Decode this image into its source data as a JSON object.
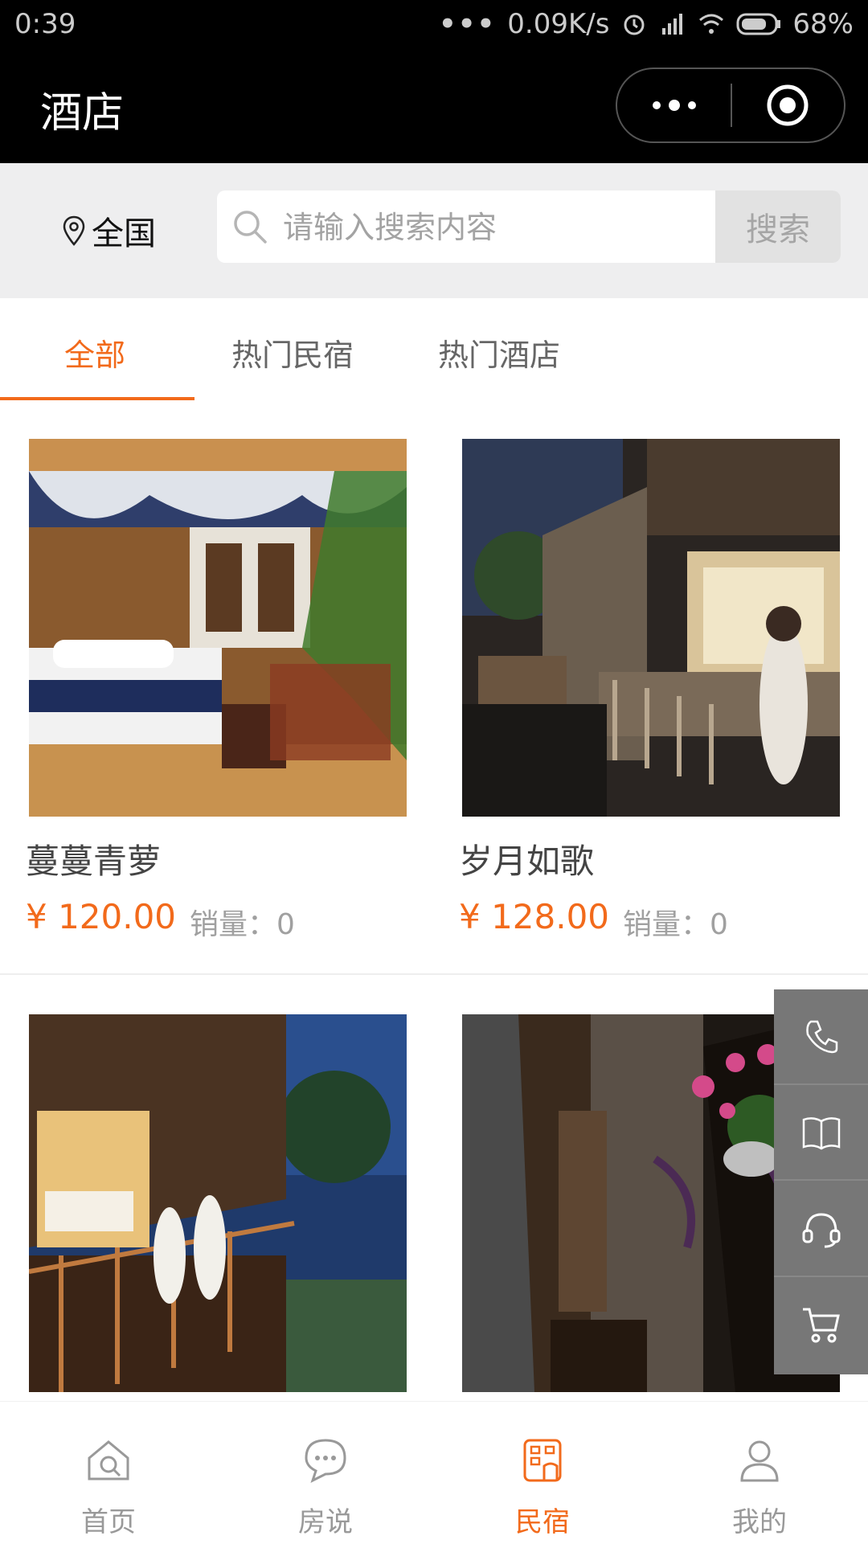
{
  "status_bar": {
    "time": "0:39",
    "dots": "•••",
    "network_speed": "0.09K/s",
    "battery": "68%"
  },
  "titlebar": {
    "title": "酒店"
  },
  "search": {
    "location": "全国",
    "placeholder": "请输入搜索内容",
    "button_label": "搜索"
  },
  "tabs": [
    {
      "label": "全部",
      "active": true
    },
    {
      "label": "热门民宿",
      "active": false
    },
    {
      "label": "热门酒店",
      "active": false
    }
  ],
  "products": [
    {
      "name": "蔓蔓青萝",
      "price": "¥ 120.00",
      "sales": "销量：0"
    },
    {
      "name": "岁月如歌",
      "price": "¥ 128.00",
      "sales": "销量：0"
    },
    {
      "name": "",
      "price": "",
      "sales": ""
    },
    {
      "name": "",
      "price": "",
      "sales": ""
    }
  ],
  "sidebar": [
    "phone-icon",
    "book-icon",
    "headset-icon",
    "cart-icon"
  ],
  "bottom_nav": [
    {
      "label": "首页",
      "icon": "home-icon",
      "active": false
    },
    {
      "label": "房说",
      "icon": "chat-icon",
      "active": false
    },
    {
      "label": "民宿",
      "icon": "hotel-icon",
      "active": true
    },
    {
      "label": "我的",
      "icon": "user-icon",
      "active": false
    }
  ],
  "colors": {
    "accent": "#f26a1b",
    "header_bg": "#000000",
    "search_bg": "#eeeeef"
  }
}
